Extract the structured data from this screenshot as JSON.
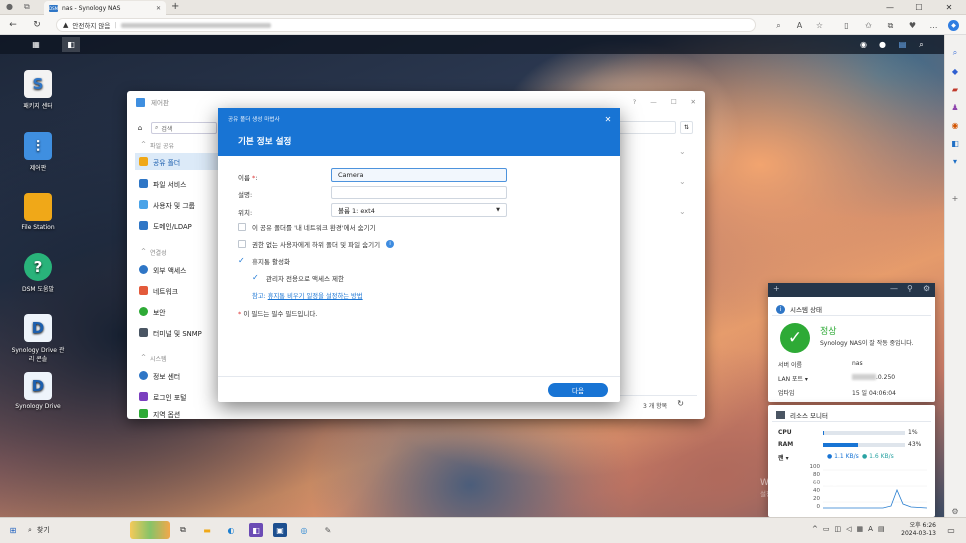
{
  "browser": {
    "tab_title": "nas - Synology NAS",
    "tab_icon": "DSM",
    "new_tab": "+",
    "security": "안전하지 않음",
    "tab_close": "✕",
    "window": {
      "minimize": "—",
      "maximize": "☐",
      "close": "✕"
    }
  },
  "desktop_icons": [
    {
      "label": "패키지 센터"
    },
    {
      "label": "제어판"
    },
    {
      "label": "File Station"
    },
    {
      "label": "DSM 도움말"
    },
    {
      "label": "Synology Drive 관리 콘솔"
    },
    {
      "label": "Synology Drive"
    }
  ],
  "control_panel": {
    "title": "제어판",
    "search_placeholder": "검색",
    "groups": [
      {
        "label": "파일 공유",
        "items": [
          "공유 폴더",
          "파일 서비스",
          "사용자 및 그룹",
          "도메인/LDAP"
        ]
      },
      {
        "label": "연결성",
        "items": [
          "외부 액세스",
          "네트워크",
          "보안",
          "터미널 및 SNMP"
        ]
      },
      {
        "label": "시스템",
        "items": [
          "정보 센터",
          "로그인 포털",
          "지역 옵션"
        ]
      }
    ],
    "footer_count": "3 개 항목",
    "help": "?",
    "minimize": "—",
    "maximize": "☐",
    "close": "✕"
  },
  "wizard": {
    "subtitle": "공유 폴더 생성 마법사",
    "title": "기본 정보 설정",
    "name_label": "이름 ",
    "name_req": "*",
    "name_colon": ":",
    "name_value": "Camera",
    "desc_label": "설명:",
    "desc_value": "",
    "location_label": "위치:",
    "location_value": "볼륨 1:  ext4",
    "opt_hide": "이 공유 폴더를 '내 네트워크 환경'에서 숨기기",
    "opt_hide_sub": "권한 없는 사용자에게 하위 폴더 및 파일 숨기기",
    "opt_recycle": "휴지통 활성화",
    "opt_admin": "관리자 전용으로 액세스 제한",
    "ref_prefix": "참고: ",
    "ref_link": "휴지통 비우기 일정을 설정하는 방법",
    "note_star": "*",
    "note": " 이 필드는 필수 필드입니다.",
    "next": "다음"
  },
  "system_status": {
    "title": "시스템 상태",
    "status": "정상",
    "status_desc": "Synology NAS이 잘 작동 중입니다.",
    "rows": [
      {
        "k": "서버 이름",
        "v": "nas"
      },
      {
        "k": "LAN 포트 ▾",
        "v": ".0.250"
      },
      {
        "k": "업타임",
        "v": "15 일 04:06:04"
      }
    ]
  },
  "resource_monitor": {
    "title": "리소스 모니터",
    "cpu_label": "CPU",
    "cpu_percent": "1%",
    "cpu_value": 1,
    "ram_label": "RAM",
    "ram_percent": "43%",
    "ram_value": 43,
    "net_label": "랜 ▾",
    "net_up": "1.1 KB/s",
    "net_down": "1.6 KB/s",
    "axis": [
      "100",
      "80",
      "60",
      "40",
      "20",
      "0"
    ]
  },
  "watermark": {
    "line1": "Windows 정품 인증",
    "line2": "설정으로 이동하여 Windows를 정품 인증합니다."
  },
  "taskbar": {
    "search": "찾기",
    "time": "오후 6:26",
    "date": "2024-03-13",
    "lang": "A"
  }
}
